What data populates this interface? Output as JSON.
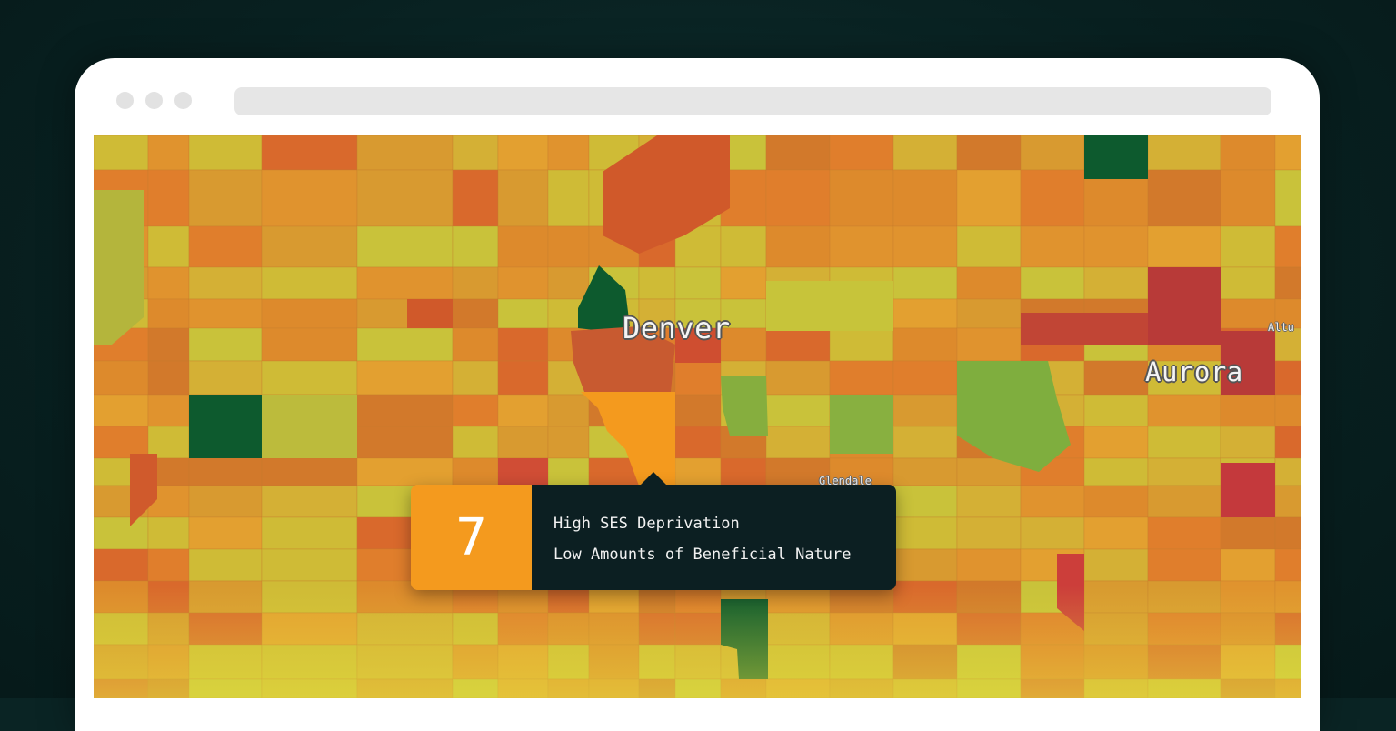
{
  "map": {
    "labels": {
      "denver": "Denver",
      "aurora": "Aurora",
      "glendale": "Glendale",
      "altura": "Altu"
    }
  },
  "tooltip": {
    "score": "7",
    "line1": "High SES Deprivation",
    "line2": "Low Amounts of Beneficial Nature"
  },
  "colors": {
    "background": "#0a2424",
    "highlight": "#f49a1e",
    "tooltip_bg": "#0c1f22",
    "dark_green": "#0d5a2e",
    "green": "#7fae3e",
    "yellow_green": "#b9c13a",
    "yellow": "#d4bb35",
    "orange": "#e08a2a",
    "red_orange": "#d0592a",
    "red": "#b83a38"
  }
}
